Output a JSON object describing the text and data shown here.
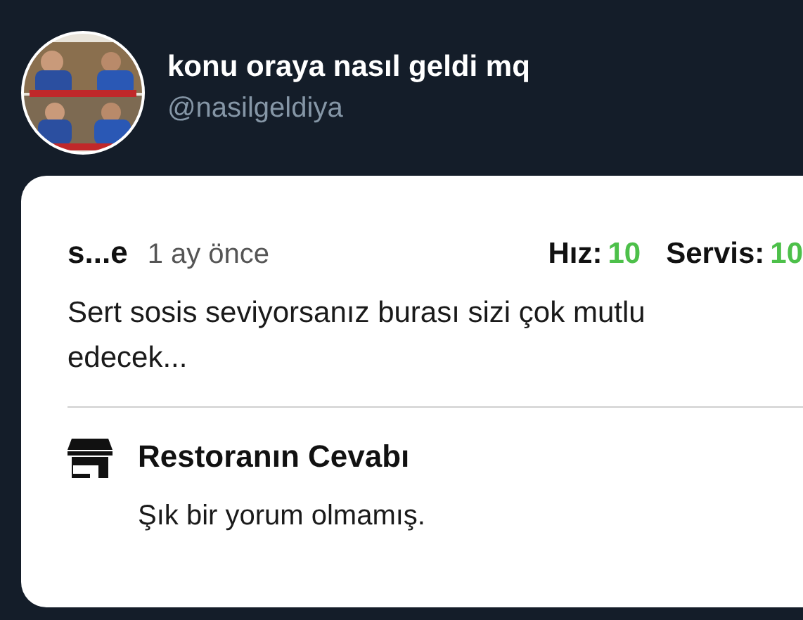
{
  "account": {
    "kind": "picture",
    "display_name": "konu oraya nasıl geldi mq",
    "handle": "@nasilgeldiya"
  },
  "review": {
    "author": "s...e",
    "time": "1 ay önce",
    "ratings": [
      {
        "label": "Hız:",
        "value": "10"
      },
      {
        "label": "Servis:",
        "value": "10"
      }
    ],
    "text": "Sert sosis seviyorsanız burası sizi çok mutlu edecek...",
    "reply": {
      "title": "Restoranın Cevabı",
      "text": "Şık bir yorum olmamış."
    }
  }
}
